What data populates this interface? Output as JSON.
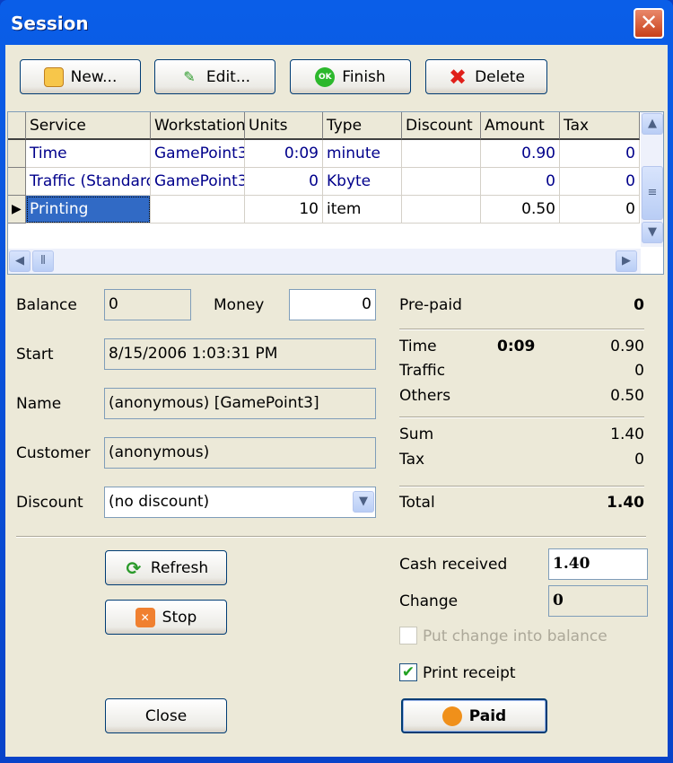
{
  "window": {
    "title": "Session",
    "close": "✕"
  },
  "toolbar": {
    "new": "New...",
    "edit": "Edit...",
    "finish": "Finish",
    "delete": "Delete"
  },
  "grid": {
    "columns": [
      "Service",
      "Workstation",
      "Units",
      "Type",
      "Discount",
      "Amount",
      "Tax"
    ],
    "rows": [
      [
        "Time",
        "GamePoint3",
        "0:09",
        "minute",
        "",
        "0.90",
        "0"
      ],
      [
        "Traffic (Standard)",
        "GamePoint3",
        "0",
        "Kbyte",
        "",
        "0",
        "0"
      ],
      [
        "Printing",
        "",
        "10",
        "item",
        "",
        "0.50",
        "0"
      ]
    ],
    "selected_row": 2
  },
  "form": {
    "balance_label": "Balance",
    "balance": "0",
    "money_label": "Money",
    "money": "0",
    "start_label": "Start",
    "start": "8/15/2006 1:03:31 PM",
    "name_label": "Name",
    "name": "(anonymous) [GamePoint3]",
    "customer_label": "Customer",
    "customer": "(anonymous)",
    "discount_label": "Discount",
    "discount": "(no discount)"
  },
  "summary": {
    "prepaid_label": "Pre-paid",
    "prepaid": "0",
    "time_label": "Time",
    "time_units": "0:09",
    "time": "0.90",
    "traffic_label": "Traffic",
    "traffic": "0",
    "others_label": "Others",
    "others": "0.50",
    "sum_label": "Sum",
    "sum": "1.40",
    "tax_label": "Tax",
    "tax": "0",
    "total_label": "Total",
    "total": "1.40"
  },
  "payment": {
    "cash_label": "Cash received",
    "cash": "1.40",
    "change_label": "Change",
    "change": "0",
    "put_change_label": "Put change into balance",
    "put_change": false,
    "print_receipt_label": "Print receipt",
    "print_receipt": true
  },
  "actions": {
    "refresh": "Refresh",
    "stop": "Stop",
    "close": "Close",
    "paid": "Paid"
  }
}
